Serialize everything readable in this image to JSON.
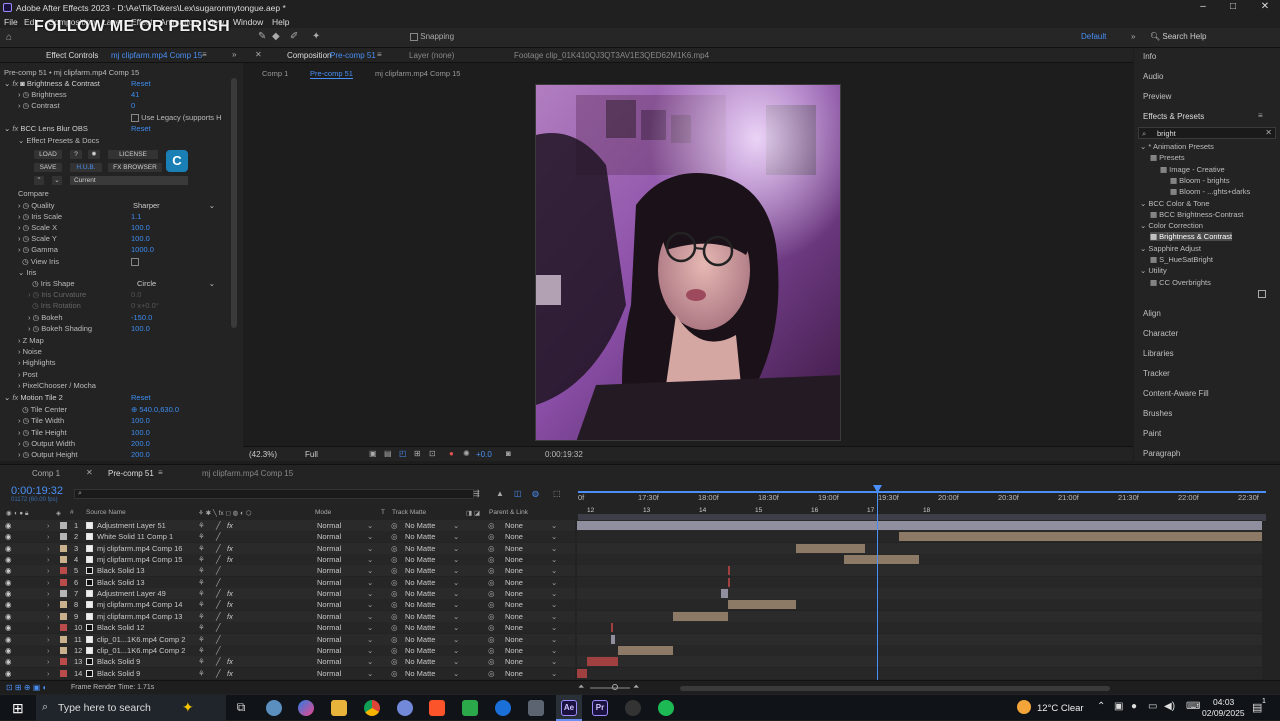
{
  "window": {
    "title": "Adobe After Effects 2023 - D:\\Ae\\TikTokers\\Lex\\sugaronmytongue.aep *",
    "controls": [
      "–",
      "□",
      "✕"
    ]
  },
  "menu": [
    "File",
    "Edit",
    "Composition",
    "Layer",
    "Effect",
    "Animation",
    "View",
    "Window",
    "Help"
  ],
  "overlay_text": "FOLLOW ME OR PERISH",
  "toolbar": {
    "snapping": "Snapping",
    "workspace": "Default",
    "search_placeholder": "Search Help"
  },
  "effect_controls": {
    "tab_label": "Effect Controls",
    "tab_target": "mj clipfarm.mp4 Comp 15",
    "breadcrumb": "Pre-comp 51 • mj clipfarm.mp4 Comp 15",
    "brightness_contrast": {
      "name": "Brightness & Contrast",
      "reset": "Reset",
      "brightness_label": "Brightness",
      "brightness_value": "41",
      "contrast_label": "Contrast",
      "contrast_value": "0",
      "legacy_label": "Use Legacy (supports H"
    },
    "lens_blur": {
      "name": "BCC Lens Blur OBS",
      "reset": "Reset",
      "presets_label": "Effect Presets & Docs",
      "btn_load": "LOAD",
      "btn_help": "?",
      "btn_license": "LICENSE",
      "btn_save": "SAVE",
      "btn_hub": "H.U.B.",
      "btn_fx": "FX BROWSER",
      "preset_current": "Current",
      "compare": "Compare",
      "quality_label": "Quality",
      "quality_value": "Sharper",
      "iris_scale_label": "Iris Scale",
      "iris_scale_value": "1.1",
      "scale_x_label": "Scale X",
      "scale_x_value": "100.0",
      "scale_y_label": "Scale Y",
      "scale_y_value": "100.0",
      "gamma_label": "Gamma",
      "gamma_value": "1000.0",
      "view_iris_label": "View Iris",
      "iris_label": "Iris",
      "iris_shape_label": "Iris Shape",
      "iris_shape_value": "Circle",
      "iris_curvature_label": "Iris Curvature",
      "iris_curvature_value": "0.0",
      "iris_rotation_label": "Iris Rotation",
      "iris_rotation_value": "0 x+0.0°",
      "bokeh_label": "Bokeh",
      "bokeh_value": "-150.0",
      "bokeh_shading_label": "Bokeh Shading",
      "bokeh_shading_value": "100.0",
      "z_map": "Z Map",
      "noise": "Noise",
      "highlights": "Highlights",
      "post": "Post",
      "pixelchooser": "PixelChooser / Mocha"
    },
    "motion_tile": {
      "name": "Motion Tile 2",
      "reset": "Reset",
      "tile_center_label": "Tile Center",
      "tile_center_value": "540.0,630.0",
      "tile_width_label": "Tile Width",
      "tile_width_value": "100.0",
      "tile_height_label": "Tile Height",
      "tile_height_value": "100.0",
      "output_width_label": "Output Width",
      "output_width_value": "200.0",
      "output_height_label": "Output Height",
      "output_height_value": "200.0"
    }
  },
  "composition": {
    "tab_label": "Composition",
    "tab_target": "Pre-comp 51",
    "layer_tab": "Layer (none)",
    "footage_tab": "Footage clip_01K410QJ3QT3AV1E3QED62M1K6.mp4",
    "nav": [
      "Comp 1",
      "Pre-comp 51",
      "mj clipfarm.mp4 Comp 15"
    ],
    "zoom": "(42.3%)",
    "quality": "Full",
    "exposure": "+0.0",
    "timecode": "0:00:19:32"
  },
  "right_panel": {
    "panels_top": [
      "Info",
      "Audio",
      "Preview"
    ],
    "effects_presets_title": "Effects & Presets",
    "search_value": "bright",
    "tree": [
      {
        "label": "* Animation Presets",
        "indent": 0
      },
      {
        "label": "Presets",
        "indent": 1
      },
      {
        "label": "Image - Creative",
        "indent": 2
      },
      {
        "label": "Bloom - brights",
        "indent": 3
      },
      {
        "label": "Bloom - ...ghts+darks",
        "indent": 3
      },
      {
        "label": "BCC Color & Tone",
        "indent": 0
      },
      {
        "label": "BCC Brightness-Contrast",
        "indent": 1
      },
      {
        "label": "Color Correction",
        "indent": 0
      },
      {
        "label": "Brightness & Contrast",
        "indent": 1,
        "selected": true
      },
      {
        "label": "Sapphire Adjust",
        "indent": 0
      },
      {
        "label": "S_HueSatBright",
        "indent": 1
      },
      {
        "label": "Utility",
        "indent": 0
      },
      {
        "label": "CC Overbrights",
        "indent": 1
      }
    ],
    "panels_bottom": [
      "Align",
      "Character",
      "Libraries",
      "Tracker",
      "Content-Aware Fill",
      "Brushes",
      "Paint",
      "Paragraph"
    ]
  },
  "timeline": {
    "tabs": [
      "Comp 1",
      "Pre-comp 51",
      "mj clipfarm.mp4 Comp 15"
    ],
    "active_tab": 1,
    "timecode": "0:00:19:32",
    "frame_info": "01172 (60.00 fps)",
    "col_headers": {
      "source": "Source Name",
      "mode": "Mode",
      "t": "T",
      "track": "Track Matte",
      "parent": "Parent & Link"
    },
    "ruler": [
      "0f",
      "17:30f",
      "18:00f",
      "18:30f",
      "19:00f",
      "19:30f",
      "20:00f",
      "20:30f",
      "21:00f",
      "21:30f",
      "22:00f",
      "22:30f"
    ],
    "markers": [
      "12",
      "13",
      "14",
      "15",
      "16",
      "17",
      "18"
    ],
    "layers": [
      {
        "n": "1",
        "name": "Adjustment Layer 51",
        "color": "#b5b5b5",
        "mode": "Normal",
        "matte": "No Matte",
        "parent": "None",
        "fx": true,
        "bar_start": 0.0,
        "bar_end": 1.0,
        "bar_color": "#8f8fa0"
      },
      {
        "n": "2",
        "name": "White Solid 11 Comp 1",
        "color": "#b5b5b5",
        "mode": "Normal",
        "matte": "No Matte",
        "parent": "None",
        "fx": false,
        "bar_start": 0.47,
        "bar_end": 1.0,
        "bar_color": "#8c7a66"
      },
      {
        "n": "3",
        "name": "mj clipfarm.mp4 Comp 16",
        "color": "#c8b18c",
        "mode": "Normal",
        "matte": "No Matte",
        "parent": "None",
        "fx": true,
        "bar_start": 0.32,
        "bar_end": 0.42,
        "bar_color": "#8c7a66"
      },
      {
        "n": "4",
        "name": "mj clipfarm.mp4 Comp 15",
        "color": "#c8b18c",
        "mode": "Normal",
        "matte": "No Matte",
        "parent": "None",
        "fx": true,
        "bar_start": 0.39,
        "bar_end": 0.5,
        "bar_color": "#8c7a66"
      },
      {
        "n": "5",
        "name": "Black Solid 13",
        "color": "#b94b4b",
        "mode": "Normal",
        "matte": "No Matte",
        "parent": "None",
        "fx": false,
        "bar_start": 0.22,
        "bar_end": 0.22,
        "bar_color": "#a04040"
      },
      {
        "n": "6",
        "name": "Black Solid 13",
        "color": "#b94b4b",
        "mode": "Normal",
        "matte": "No Matte",
        "parent": "None",
        "fx": false,
        "bar_start": 0.22,
        "bar_end": 0.22,
        "bar_color": "#a04040"
      },
      {
        "n": "7",
        "name": "Adjustment Layer 49",
        "color": "#b5b5b5",
        "mode": "Normal",
        "matte": "No Matte",
        "parent": "None",
        "fx": true,
        "bar_start": 0.21,
        "bar_end": 0.22,
        "bar_color": "#8f8fa0"
      },
      {
        "n": "8",
        "name": "mj clipfarm.mp4 Comp 14",
        "color": "#c8b18c",
        "mode": "Normal",
        "matte": "No Matte",
        "parent": "None",
        "fx": true,
        "bar_start": 0.22,
        "bar_end": 0.32,
        "bar_color": "#8c7a66"
      },
      {
        "n": "9",
        "name": "mj clipfarm.mp4 Comp 13",
        "color": "#c8b18c",
        "mode": "Normal",
        "matte": "No Matte",
        "parent": "None",
        "fx": true,
        "bar_start": 0.14,
        "bar_end": 0.22,
        "bar_color": "#8c7a66"
      },
      {
        "n": "10",
        "name": "Black Solid 12",
        "color": "#b94b4b",
        "mode": "Normal",
        "matte": "No Matte",
        "parent": "None",
        "fx": false,
        "bar_start": 0.05,
        "bar_end": 0.05,
        "bar_color": "#a04040"
      },
      {
        "n": "11",
        "name": "clip_01...1K6.mp4 Comp 2",
        "color": "#c8b18c",
        "mode": "Normal",
        "matte": "No Matte",
        "parent": "None",
        "fx": false,
        "bar_start": 0.05,
        "bar_end": 0.055,
        "bar_color": "#8f8fa0"
      },
      {
        "n": "12",
        "name": "clip_01...1K6.mp4 Comp 2",
        "color": "#c8b18c",
        "mode": "Normal",
        "matte": "No Matte",
        "parent": "None",
        "fx": false,
        "bar_start": 0.06,
        "bar_end": 0.14,
        "bar_color": "#8c7a66"
      },
      {
        "n": "13",
        "name": "Black Solid 9",
        "color": "#b94b4b",
        "mode": "Normal",
        "matte": "No Matte",
        "parent": "None",
        "fx": true,
        "bar_start": 0.015,
        "bar_end": 0.06,
        "bar_color": "#a04040"
      },
      {
        "n": "14",
        "name": "Black Solid 9",
        "color": "#b94b4b",
        "mode": "Normal",
        "matte": "No Matte",
        "parent": "None",
        "fx": true,
        "bar_start": 0.0,
        "bar_end": 0.015,
        "bar_color": "#a04040"
      }
    ],
    "playhead": 0.5,
    "render_time": "Frame Render Time: 1.71s"
  },
  "taskbar": {
    "search_placeholder": "Type here to search",
    "weather": "12°C  Clear",
    "time": "04:03",
    "date": "02/09/2025",
    "notif": "1"
  }
}
